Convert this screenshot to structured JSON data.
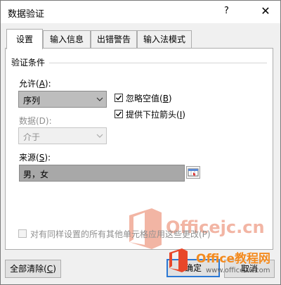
{
  "window": {
    "title": "数据验证",
    "help_label": "?",
    "close_label": "✕"
  },
  "tabs": [
    {
      "label": "设置",
      "active": true
    },
    {
      "label": "输入信息",
      "active": false
    },
    {
      "label": "出错警告",
      "active": false
    },
    {
      "label": "输入法模式",
      "active": false
    }
  ],
  "validation": {
    "group_title": "验证条件",
    "allow_label": "允许(",
    "allow_key": "A",
    "allow_label_end": "):",
    "allow_value": "序列",
    "data_label": "数据(D):",
    "data_value": "介于",
    "ignore_blank": {
      "label": "忽略空值(",
      "key": "B",
      "end": ")",
      "checked": true
    },
    "dropdown": {
      "label": "提供下拉箭头(",
      "key": "I",
      "end": ")",
      "checked": true
    },
    "source_label": "来源(",
    "source_key": "S",
    "source_label_end": "):",
    "source_value": "男，女",
    "apply_all": {
      "label": "对有同样设置的所有其他单元格应用这些更改(P)",
      "checked": false,
      "enabled": false
    }
  },
  "buttons": {
    "clear_all_label": "全部清除(",
    "clear_all_key": "C",
    "clear_all_end": ")",
    "ok_label": "确定",
    "cancel_label": "取消"
  },
  "watermarks": {
    "center_text": "Officejc.cn",
    "brand_title": "Office教程网",
    "brand_sub": "www.office26.com"
  },
  "colors": {
    "accent": "#2b78d4",
    "watermark_orange": "#e8795a"
  }
}
